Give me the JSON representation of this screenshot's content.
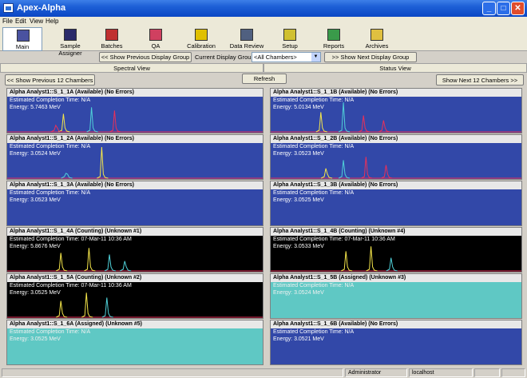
{
  "window": {
    "title": "Apex-Alpha"
  },
  "menu": [
    "File",
    "Edit",
    "View",
    "Help"
  ],
  "toolbar": {
    "items": [
      {
        "label": "Main",
        "icon": "main-icon",
        "active": true
      },
      {
        "label": "Sample Assigner",
        "icon": "sample-assigner-icon",
        "active": false
      },
      {
        "label": "Batches",
        "icon": "batches-icon",
        "active": false
      },
      {
        "label": "QA",
        "icon": "qa-icon",
        "active": false
      },
      {
        "label": "Calibration",
        "icon": "calibration-icon",
        "active": false
      },
      {
        "label": "Data Review",
        "icon": "data-review-icon",
        "active": false
      },
      {
        "label": "Setup",
        "icon": "setup-icon",
        "active": false
      },
      {
        "label": "Reports",
        "icon": "reports-icon",
        "active": false
      },
      {
        "label": "Archives",
        "icon": "archives-icon",
        "active": false
      }
    ]
  },
  "nav": {
    "prev_group": "<< Show Previous Display Group",
    "group_label": "Current Display Group:",
    "group_value": "<All Chambers>",
    "next_group": ">> Show Next Display Group"
  },
  "views": {
    "spectral": "Spectral View",
    "status": "Status View"
  },
  "chambers_nav": {
    "prev": "<< Show Previous 12 Chambers",
    "refresh": "Refresh",
    "next": "Show Next 12 Chambers >>"
  },
  "panels": [
    {
      "title": "Alpha Analyst1::S_1_1A (Available) (No Errors)",
      "completion": "Estimated Completion Time:  N/A",
      "energy": "Energy: 5.7463 MeV",
      "bg": "blue",
      "peaks": [
        {
          "x": 0.22,
          "h": 0.55,
          "c": "#f5e64a"
        },
        {
          "x": 0.33,
          "h": 0.75,
          "c": "#4fd1d9"
        },
        {
          "x": 0.42,
          "h": 0.65,
          "c": "#e8305a"
        },
        {
          "x": 0.19,
          "h": 0.2,
          "c": "#e8305a"
        }
      ]
    },
    {
      "title": "Alpha Analyst1::S_1_1B (Available) (No Errors)",
      "completion": "Estimated Completion Time:  N/A",
      "energy": "Energy: 5.0134 MeV",
      "bg": "blue",
      "peaks": [
        {
          "x": 0.2,
          "h": 0.6,
          "c": "#f5e64a"
        },
        {
          "x": 0.29,
          "h": 0.9,
          "c": "#4fd1d9"
        },
        {
          "x": 0.37,
          "h": 0.5,
          "c": "#e8305a"
        },
        {
          "x": 0.45,
          "h": 0.35,
          "c": "#e8305a"
        }
      ]
    },
    {
      "title": "Alpha Analyst1::S_1_2A (Available) (No Errors)",
      "completion": "Estimated Completion Time:  N/A",
      "energy": "Energy: 3.0524 MeV",
      "bg": "blue",
      "peaks": [
        {
          "x": 0.37,
          "h": 0.95,
          "c": "#f5e64a"
        },
        {
          "x": 0.23,
          "h": 0.15,
          "c": "#4fd1d9"
        }
      ]
    },
    {
      "title": "Alpha Analyst1::S_1_2B (Available) (No Errors)",
      "completion": "Estimated Completion Time:  N/A",
      "energy": "Energy: 3.0523 MeV",
      "bg": "blue",
      "peaks": [
        {
          "x": 0.22,
          "h": 0.3,
          "c": "#f5e64a"
        },
        {
          "x": 0.29,
          "h": 0.55,
          "c": "#4fd1d9"
        },
        {
          "x": 0.38,
          "h": 0.65,
          "c": "#e8305a"
        },
        {
          "x": 0.46,
          "h": 0.4,
          "c": "#e8305a"
        }
      ]
    },
    {
      "title": "Alpha Analyst1::S_1_3A (Available) (No Errors)",
      "completion": "Estimated Completion Time:  N/A",
      "energy": "Energy: 3.0523 MeV",
      "bg": "blue",
      "peaks": []
    },
    {
      "title": "Alpha Analyst1::S_1_3B (Available) (No Errors)",
      "completion": "Estimated Completion Time:  N/A",
      "energy": "Energy: 3.0525 MeV",
      "bg": "blue",
      "peaks": []
    },
    {
      "title": "Alpha Analyst1::S_1_4A (Counting) (Unknown #1)",
      "completion": "Estimated Completion Time:  07-Mar-11 10:36 AM",
      "energy": "Energy: 5.8676 MeV",
      "bg": "black",
      "peaks": [
        {
          "x": 0.21,
          "h": 0.55,
          "c": "#f5e64a"
        },
        {
          "x": 0.32,
          "h": 0.7,
          "c": "#f5e64a"
        },
        {
          "x": 0.4,
          "h": 0.5,
          "c": "#4fd1d9"
        },
        {
          "x": 0.46,
          "h": 0.3,
          "c": "#4fd1d9"
        }
      ]
    },
    {
      "title": "Alpha Analyst1::S_1_4B (Counting) (Unknown #4)",
      "completion": "Estimated Completion Time:  07-Mar-11 10:36 AM",
      "energy": "Energy: 3.0533 MeV",
      "bg": "black",
      "peaks": [
        {
          "x": 0.3,
          "h": 0.6,
          "c": "#f5e64a"
        },
        {
          "x": 0.4,
          "h": 0.75,
          "c": "#f5e64a"
        },
        {
          "x": 0.48,
          "h": 0.4,
          "c": "#4fd1d9"
        }
      ]
    },
    {
      "title": "Alpha Analyst1::S_1_5A (Counting) (Unknown #2)",
      "completion": "Estimated Completion Time:  07-Mar-11 10:36 AM",
      "energy": "Energy: 3.0525 MeV",
      "bg": "black",
      "peaks": [
        {
          "x": 0.21,
          "h": 0.5,
          "c": "#f5e64a"
        },
        {
          "x": 0.31,
          "h": 0.75,
          "c": "#f5e64a"
        },
        {
          "x": 0.39,
          "h": 0.6,
          "c": "#4fd1d9"
        }
      ]
    },
    {
      "title": "Alpha Analyst1::S_1_5B (Assigned) (Unknown #3)",
      "completion": "Estimated Completion Time:  N/A",
      "energy": "Energy: 3.0524 MeV",
      "bg": "teal",
      "peaks": []
    },
    {
      "title": "Alpha Analyst1::S_1_6A (Assigned) (Unknown #5)",
      "completion": "Estimated Completion Time:  N/A",
      "energy": "Energy: 3.0525 MeV",
      "bg": "teal",
      "peaks": []
    },
    {
      "title": "Alpha Analyst1::S_1_6B (Available) (No Errors)",
      "completion": "Estimated Completion Time:  N/A",
      "energy": "Energy: 3.0521 MeV",
      "bg": "blue",
      "peaks": []
    }
  ],
  "status": {
    "user": "Administrator",
    "host": "localhost"
  }
}
